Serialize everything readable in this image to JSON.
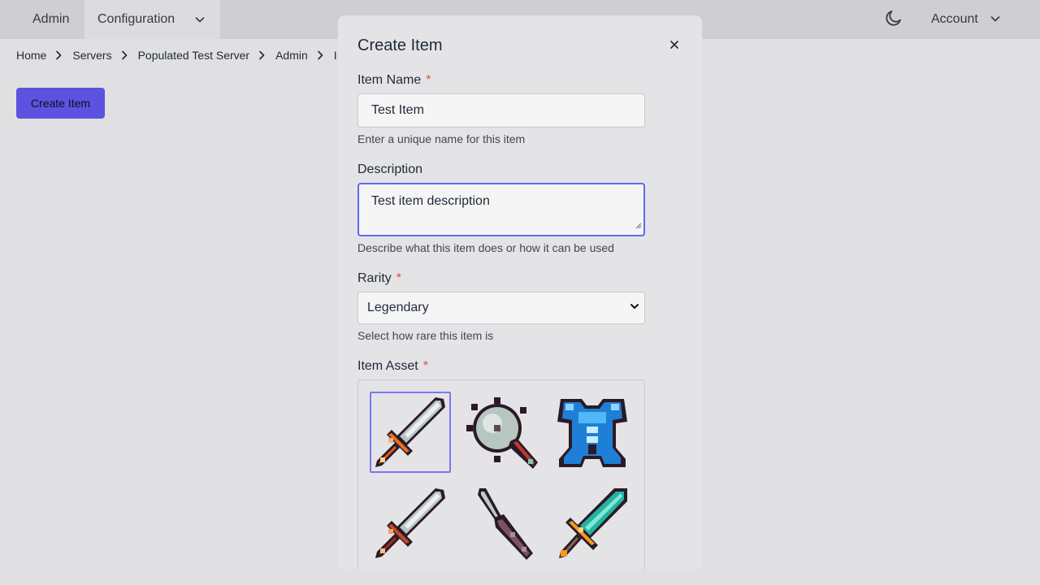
{
  "nav": {
    "admin": "Admin",
    "configuration": "Configuration",
    "account": "Account"
  },
  "breadcrumb": [
    "Home",
    "Servers",
    "Populated Test Server",
    "Admin",
    "I"
  ],
  "page": {
    "create_button": "Create Item"
  },
  "modal": {
    "title": "Create Item",
    "name": {
      "label": "Item Name",
      "value": "Test Item",
      "help": "Enter a unique name for this item"
    },
    "description": {
      "label": "Description",
      "value": "Test item description",
      "help": "Describe what this item does or how it can be used"
    },
    "rarity": {
      "label": "Rarity",
      "value": "Legendary",
      "help": "Select how rare this item is"
    },
    "asset": {
      "label": "Item Asset",
      "items": [
        {
          "name": "sword-orange-hilt-icon",
          "selected": true
        },
        {
          "name": "spiked-mace-icon",
          "selected": false
        },
        {
          "name": "blue-armor-icon",
          "selected": false
        },
        {
          "name": "sword-red-hilt-icon",
          "selected": false
        },
        {
          "name": "dagger-icon",
          "selected": false
        },
        {
          "name": "teal-sword-icon",
          "selected": false
        }
      ]
    }
  },
  "colors": {
    "accent": "#5b52e0",
    "focus": "#6366f1",
    "required": "#ef4444"
  }
}
